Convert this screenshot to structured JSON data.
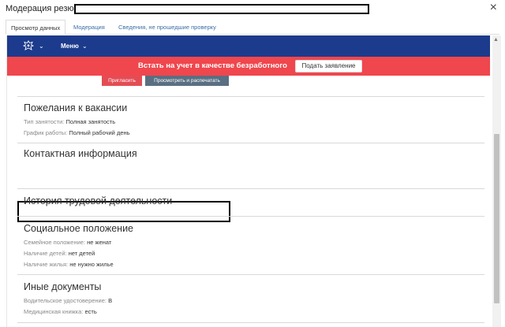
{
  "window": {
    "title": "Модерация резюме",
    "close_glyph": "×"
  },
  "tabs": [
    {
      "label": "Просмотр данных"
    },
    {
      "label": "Модерация"
    },
    {
      "label": "Сведения, не прошедшие проверку"
    }
  ],
  "navbar": {
    "menu_label": "Меню",
    "chevron": "⌄"
  },
  "banner": {
    "text": "Встать на учет в качестве безработного",
    "button": "Подать заявление"
  },
  "actions": {
    "invite": "Пригласить",
    "print": "Просмотреть и распечатать"
  },
  "sections": {
    "wishes": {
      "title": "Пожелания к вакансии",
      "rows": [
        {
          "label": "Тип занятости:",
          "value": "Полная занятость"
        },
        {
          "label": "График работы:",
          "value": "Полный рабочий день"
        }
      ]
    },
    "contacts": {
      "title": "Контактная информация"
    },
    "history": {
      "title": "История трудовой деятельности"
    },
    "social": {
      "title": "Социальное положение",
      "rows": [
        {
          "label": "Семейное положение:",
          "value": "не женат"
        },
        {
          "label": "Наличие детей:",
          "value": "нет детей"
        },
        {
          "label": "Наличие жилья:",
          "value": "не нужно жилье"
        }
      ]
    },
    "docs": {
      "title": "Иные документы",
      "rows": [
        {
          "label": "Водительское удостоверение:",
          "value": "В"
        },
        {
          "label": "Медицинская книжка:",
          "value": "есть"
        }
      ]
    }
  },
  "colors": {
    "navbar": "#1d3b8c",
    "banner": "#f0464d",
    "invite": "#e44c54",
    "print": "#5a6f82"
  }
}
